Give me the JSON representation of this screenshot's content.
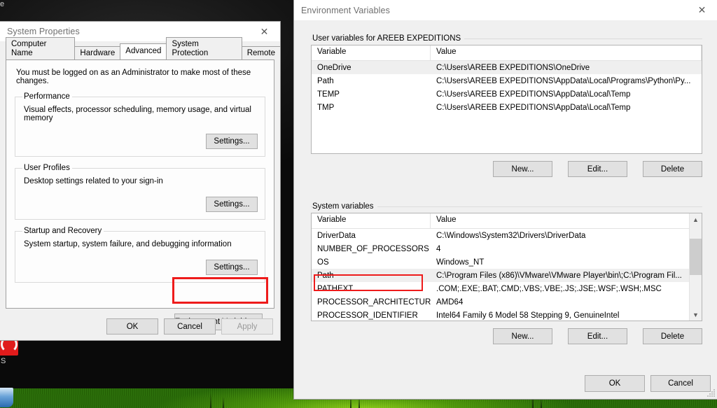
{
  "desktop": {
    "corner_label_top": "e",
    "corner_label_bottom": "S",
    "wallpaper_colors": {
      "top": "#0a0a0a",
      "grass": "#4e9a08"
    }
  },
  "system_properties": {
    "title": "System Properties",
    "close_icon": "close-icon",
    "tabs": [
      {
        "label": "Computer Name",
        "active": false
      },
      {
        "label": "Hardware",
        "active": false
      },
      {
        "label": "Advanced",
        "active": true
      },
      {
        "label": "System Protection",
        "active": false
      },
      {
        "label": "Remote",
        "active": false
      }
    ],
    "admin_note": "You must be logged on as an Administrator to make most of these changes.",
    "groups": [
      {
        "legend": "Performance",
        "description": "Visual effects, processor scheduling, memory usage, and virtual memory",
        "button": "Settings..."
      },
      {
        "legend": "User Profiles",
        "description": "Desktop settings related to your sign-in",
        "button": "Settings..."
      },
      {
        "legend": "Startup and Recovery",
        "description": "System startup, system failure, and debugging information",
        "button": "Settings..."
      }
    ],
    "environment_variables_button": "Environment Variables...",
    "footer": {
      "ok": "OK",
      "cancel": "Cancel",
      "apply": "Apply",
      "apply_disabled": true
    },
    "highlight_color": "#ee1b1b"
  },
  "environment_variables": {
    "title": "Environment Variables",
    "close_icon": "close-icon",
    "user_section": {
      "label": "User variables for AREEB EXPEDITIONS",
      "columns": [
        "Variable",
        "Value"
      ],
      "rows": [
        {
          "variable": "OneDrive",
          "value": "C:\\Users\\AREEB EXPEDITIONS\\OneDrive",
          "selected": true
        },
        {
          "variable": "Path",
          "value": "C:\\Users\\AREEB EXPEDITIONS\\AppData\\Local\\Programs\\Python\\Py...",
          "selected": false
        },
        {
          "variable": "TEMP",
          "value": "C:\\Users\\AREEB EXPEDITIONS\\AppData\\Local\\Temp",
          "selected": false
        },
        {
          "variable": "TMP",
          "value": "C:\\Users\\AREEB EXPEDITIONS\\AppData\\Local\\Temp",
          "selected": false
        }
      ],
      "buttons": {
        "new": "New...",
        "edit": "Edit...",
        "delete": "Delete"
      }
    },
    "system_section": {
      "label": "System variables",
      "columns": [
        "Variable",
        "Value"
      ],
      "rows": [
        {
          "variable": "DriverData",
          "value": "C:\\Windows\\System32\\Drivers\\DriverData",
          "selected": false
        },
        {
          "variable": "NUMBER_OF_PROCESSORS",
          "value": "4",
          "selected": false
        },
        {
          "variable": "OS",
          "value": "Windows_NT",
          "selected": false
        },
        {
          "variable": "Path",
          "value": "C:\\Program Files (x86)\\VMware\\VMware Player\\bin\\;C:\\Program Fil...",
          "selected": true
        },
        {
          "variable": "PATHEXT",
          "value": ".COM;.EXE;.BAT;.CMD;.VBS;.VBE;.JS;.JSE;.WSF;.WSH;.MSC",
          "selected": false
        },
        {
          "variable": "PROCESSOR_ARCHITECTURE",
          "value": "AMD64",
          "selected": false
        },
        {
          "variable": "PROCESSOR_IDENTIFIER",
          "value": "Intel64 Family 6 Model 58 Stepping 9, GenuineIntel",
          "selected": false
        }
      ],
      "buttons": {
        "new": "New...",
        "edit": "Edit...",
        "delete": "Delete"
      },
      "scrollbar": {
        "up_icon": "chevron-up-icon",
        "down_icon": "chevron-down-icon"
      }
    },
    "footer": {
      "ok": "OK",
      "cancel": "Cancel"
    },
    "highlight_color": "#ee1b1b"
  }
}
